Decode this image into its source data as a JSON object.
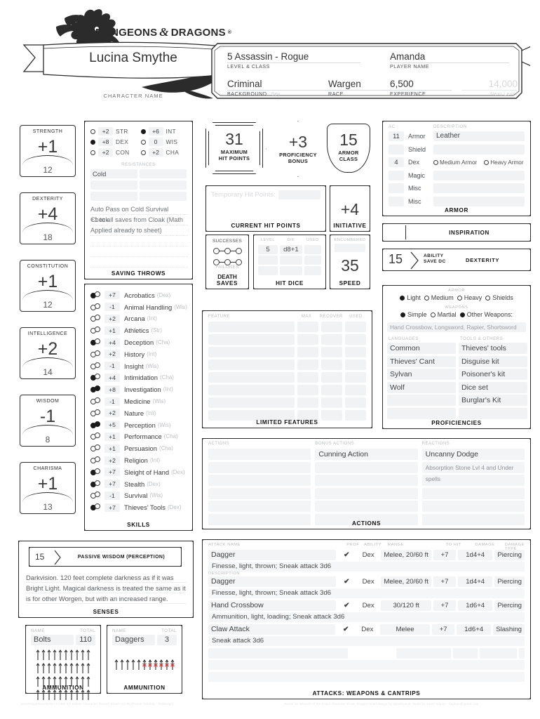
{
  "header": {
    "logo_text": "DUNGEONS",
    "logo_amp": "&",
    "logo_text2": "DRAGONS",
    "logo_reg": "®",
    "character_name": "Lucina Smythe",
    "character_name_label": "CHARACTER NAME",
    "level_class": "5  Assassin - Rogue",
    "level_class_label": "LEVEL & CLASS",
    "player_name": "Amanda",
    "player_name_label": "PLAYER NAME",
    "background": "Criminal",
    "background_label": "BACKGROUND",
    "background_sub": "Spy",
    "race": "Wargen",
    "race_label": "RACE",
    "experience": "6,500",
    "experience_label": "EXPERIENCE",
    "next_level": "14,000",
    "next_level_label": "Next Level"
  },
  "abilities": [
    {
      "name": "STRENGTH",
      "mod": "+1",
      "score": "12"
    },
    {
      "name": "DEXTERITY",
      "mod": "+4",
      "score": "18"
    },
    {
      "name": "CONSTITUTION",
      "mod": "+1",
      "score": "12"
    },
    {
      "name": "INTELLIGENCE",
      "mod": "+2",
      "score": "14"
    },
    {
      "name": "WISDOM",
      "mod": "-1",
      "score": "8"
    },
    {
      "name": "CHARISMA",
      "mod": "+1",
      "score": "13"
    }
  ],
  "saving_throws": {
    "title": "SAVING THROWS",
    "resistances_label": "RESISTANCES",
    "entries": [
      {
        "abbr": "STR",
        "value": "+2",
        "proficient": false
      },
      {
        "abbr": "INT",
        "value": "+6",
        "proficient": true
      },
      {
        "abbr": "DEX",
        "value": "+8",
        "proficient": true
      },
      {
        "abbr": "WIS",
        "value": "0",
        "proficient": false
      },
      {
        "abbr": "CON",
        "value": "+2",
        "proficient": false
      },
      {
        "abbr": "CHA",
        "value": "+2",
        "proficient": false
      }
    ],
    "resistances": [
      "Cold",
      "",
      "",
      "",
      "",
      ""
    ],
    "notes": [
      "Auto Pass on Cold Survival Check",
      "+1 to all saves from Cloak (Math",
      "Applied already to sheet)",
      "",
      "",
      ""
    ]
  },
  "skills": {
    "title": "SKILLS",
    "rows": [
      {
        "value": "+7",
        "name": "Acrobatics",
        "ability": "(Dex)",
        "prof": true,
        "expertise": false
      },
      {
        "value": "-1",
        "name": "Animal Handling",
        "ability": "(Wis)",
        "prof": false,
        "expertise": false
      },
      {
        "value": "+2",
        "name": "Arcana",
        "ability": "(Int)",
        "prof": false,
        "expertise": false
      },
      {
        "value": "+1",
        "name": "Athletics",
        "ability": "(Str)",
        "prof": false,
        "expertise": false
      },
      {
        "value": "+4",
        "name": "Deception",
        "ability": "(Cha)",
        "prof": true,
        "expertise": false
      },
      {
        "value": "+2",
        "name": "History",
        "ability": "(Int)",
        "prof": false,
        "expertise": false
      },
      {
        "value": "-1",
        "name": "Insight",
        "ability": "(Wis)",
        "prof": false,
        "expertise": false
      },
      {
        "value": "+4",
        "name": "Intimidation",
        "ability": "(Cha)",
        "prof": true,
        "expertise": false
      },
      {
        "value": "+8",
        "name": "Investigation",
        "ability": "(Int)",
        "prof": true,
        "expertise": true
      },
      {
        "value": "-1",
        "name": "Medicine",
        "ability": "(Wis)",
        "prof": false,
        "expertise": false
      },
      {
        "value": "+2",
        "name": "Nature",
        "ability": "(Int)",
        "prof": false,
        "expertise": false
      },
      {
        "value": "+5",
        "name": "Perception",
        "ability": "(Wis)",
        "prof": true,
        "expertise": true
      },
      {
        "value": "+1",
        "name": "Performance",
        "ability": "(Cha)",
        "prof": false,
        "expertise": false
      },
      {
        "value": "+1",
        "name": "Persuasion",
        "ability": "(Cha)",
        "prof": false,
        "expertise": false
      },
      {
        "value": "+2",
        "name": "Religion",
        "ability": "(Int)",
        "prof": false,
        "expertise": false
      },
      {
        "value": "+7",
        "name": "Sleight of Hand",
        "ability": "(Dex)",
        "prof": true,
        "expertise": false
      },
      {
        "value": "+7",
        "name": "Stealth",
        "ability": "(Dex)",
        "prof": true,
        "expertise": false
      },
      {
        "value": "-1",
        "name": "Survival",
        "ability": "(Wis)",
        "prof": false,
        "expertise": false
      },
      {
        "value": "+7",
        "name": "Thieves' Tools",
        "ability": "(Dex)",
        "prof": true,
        "expertise": false
      }
    ]
  },
  "combat": {
    "max_hp": "31",
    "max_hp_label_1": "MAXIMUM",
    "max_hp_label_2": "HIT POINTS",
    "proficiency_bonus": "+3",
    "prof_label_1": "PROFICIENCY",
    "prof_label_2": "BONUS",
    "armor_class": "15",
    "ac_label_1": "ARMOR",
    "ac_label_2": "CLASS",
    "temp_hp_label": "Temporary Hit Points:",
    "temp_hp_value": "",
    "current_hp_label": "CURRENT HIT POINTS",
    "current_hp_value": "",
    "initiative": "+4",
    "initiative_label": "INITIATIVE",
    "death_saves_label_1": "DEATH",
    "death_saves_label_2": "SAVES",
    "successes_label": "SUCCESSES",
    "failures_label": "FAILURES",
    "hit_dice_label": "HIT DICE",
    "hit_dice_cols": [
      "LEVEL",
      "DIE",
      "USED"
    ],
    "hit_dice_rows": [
      {
        "level": "5",
        "die": "d8+1",
        "used": ""
      },
      {
        "level": "",
        "die": "",
        "used": ""
      },
      {
        "level": "",
        "die": "",
        "used": ""
      }
    ],
    "encumbered_label": "ENCUMBERED",
    "encumbered_value": "",
    "speed": "35",
    "speed_label": "SPEED"
  },
  "armor": {
    "title": "ARMOR",
    "ac_col_label": "AC",
    "desc_col_label": "DESCRIPTION",
    "rows": [
      {
        "ac": "11",
        "key": "Armor",
        "desc": "Leather"
      },
      {
        "ac": "",
        "key": "Shield",
        "desc": ""
      },
      {
        "ac": "4",
        "key": "Dex",
        "desc": ""
      },
      {
        "ac": "",
        "key": "Magic",
        "desc": ""
      },
      {
        "ac": "",
        "key": "Misc",
        "desc": ""
      },
      {
        "ac": "",
        "key": "Misc",
        "desc": ""
      }
    ],
    "medium_armor_label": "Medium Armor",
    "heavy_armor_label": "Heavy Armor",
    "medium_armor_checked": false,
    "heavy_armor_checked": false
  },
  "inspiration": {
    "label": "INSPIRATION",
    "value": ""
  },
  "save_dc": {
    "value": "15",
    "label_1": "ABILITY",
    "label_2": "SAVE DC",
    "ability": "DEXTERITY"
  },
  "proficiencies": {
    "title": "PROFICIENCIES",
    "armor_label": "ARMOR",
    "armor_options": [
      {
        "label": "Light",
        "checked": true
      },
      {
        "label": "Medium",
        "checked": false
      },
      {
        "label": "Heavy",
        "checked": false
      },
      {
        "label": "Shields",
        "checked": false
      }
    ],
    "weapons_label": "WEAPONS",
    "weapon_options": [
      {
        "label": "Simple",
        "checked": true
      },
      {
        "label": "Martial",
        "checked": false
      },
      {
        "label": "Other Weapons:",
        "checked": true
      }
    ],
    "other_weapons": "Hand Crossbow, Longsword, Rapier, Shortsword",
    "languages_label": "LANGUAGES",
    "tools_label": "TOOLS & OTHERS",
    "languages": [
      "Common",
      "Thieves' Cant",
      "Sylvan",
      "Wolf",
      "",
      ""
    ],
    "tools": [
      "Thieves' tools",
      "Disguise kit",
      "Poisoner's kit",
      "Dice set",
      "Burglar's Kit",
      ""
    ]
  },
  "limited_features": {
    "title": "LIMITED FEATURES",
    "columns": [
      "FEATURE",
      "MAX",
      "RECOVER",
      "USED"
    ],
    "rows": [
      {
        "feature": "",
        "max": "",
        "recover": "",
        "used": ""
      },
      {
        "feature": "",
        "max": "",
        "recover": "",
        "used": ""
      },
      {
        "feature": "",
        "max": "",
        "recover": "",
        "used": ""
      },
      {
        "feature": "",
        "max": "",
        "recover": "",
        "used": ""
      },
      {
        "feature": "",
        "max": "",
        "recover": "",
        "used": ""
      },
      {
        "feature": "",
        "max": "",
        "recover": "",
        "used": ""
      },
      {
        "feature": "",
        "max": "",
        "recover": "",
        "used": ""
      },
      {
        "feature": "",
        "max": "",
        "recover": "",
        "used": ""
      }
    ]
  },
  "actions": {
    "title": "ACTIONS",
    "columns": [
      "ACTIONS",
      "BONUS ACTIONS",
      "REACTIONS"
    ],
    "actions": [
      "",
      "",
      "",
      "",
      "",
      ""
    ],
    "bonus_actions": [
      "Cunning Action",
      "",
      "",
      "",
      "",
      ""
    ],
    "reactions": [
      "Uncanny Dodge",
      "Absorption Stone Lvl 4 and Under spells",
      "",
      "",
      "",
      ""
    ]
  },
  "attacks": {
    "title": "ATTACKS: WEAPONS & CANTRIPS",
    "columns": {
      "name": "ATTACK NAME",
      "prof": "PROF",
      "ability": "ABILITY",
      "range": "RANGE",
      "to_hit": "TO HIT",
      "damage": "DAMAGE",
      "damage_type": "DAMAGE TYPE",
      "description": "DESCRIPTION"
    },
    "rows": [
      {
        "name": "Dagger",
        "prof": "✔",
        "ability": "Dex",
        "range": "Melee, 20/60 ft",
        "to_hit": "+7",
        "damage": "1d4+4",
        "damage_type": "Piercing",
        "description": "Finesse, light, thrown; Sneak attack 3d6"
      },
      {
        "name": "Dagger",
        "prof": "✔",
        "ability": "Dex",
        "range": "Melee, 20/60 ft",
        "to_hit": "+7",
        "damage": "1d4+4",
        "damage_type": "Piercing",
        "description": "Finesse, light, thrown; Sneak attack 3d6"
      },
      {
        "name": "Hand Crossbow",
        "prof": "✔",
        "ability": "Dex",
        "range": "30/120 ft",
        "to_hit": "+7",
        "damage": "1d6+4",
        "damage_type": "Piercing",
        "description": "Ammunition, light, loading; Sneak attack 3d6"
      },
      {
        "name": "Claw Attack",
        "prof": "✔",
        "ability": "Dex",
        "range": "Melee",
        "to_hit": "+7",
        "damage": "1d6+4",
        "damage_type": "Slashing",
        "description": "Sneak attack 3d6"
      },
      {
        "name": "",
        "prof": "",
        "ability": "",
        "range": "",
        "to_hit": "",
        "damage": "",
        "damage_type": "",
        "description": ""
      }
    ]
  },
  "senses": {
    "title": "SENSES",
    "passive_value": "15",
    "passive_label": "PASSIVE WISDOM (PERCEPTION)",
    "notes": [
      "Darkvision. 120 feet complete darkness as if it was",
      "Bright Light. Magical darkness is treated the same as it",
      "is for other Worgen, but with an increased range."
    ]
  },
  "ammunition": [
    {
      "title": "AMMUNITION",
      "name_label": "NAME",
      "total_label": "TOTAL",
      "name": "Bolts",
      "total": "110",
      "rows": 4,
      "per_row": 10,
      "used": 0
    },
    {
      "title": "AMMUNITION",
      "name_label": "NAME",
      "total_label": "TOTAL",
      "name": "Daggers",
      "total": "3",
      "rows": 1,
      "per_row": 11,
      "used": 6
    }
  ],
  "footer": {
    "left": "MorePurpleMoreBetter's D&D 5th edition Character Record Sheet v13.95 (Printer Friendly - Redesign)",
    "right": "Based on Wizards of the Coast character sheet; Dragon Head design by splashcircle; made by Jared Wijnen - flapkan@gmail.com"
  },
  "colors": {
    "ink": "#2b2b2b",
    "field": "#f1f2f4",
    "muted": "#b9bcc0",
    "accent_red": "#e03434"
  }
}
